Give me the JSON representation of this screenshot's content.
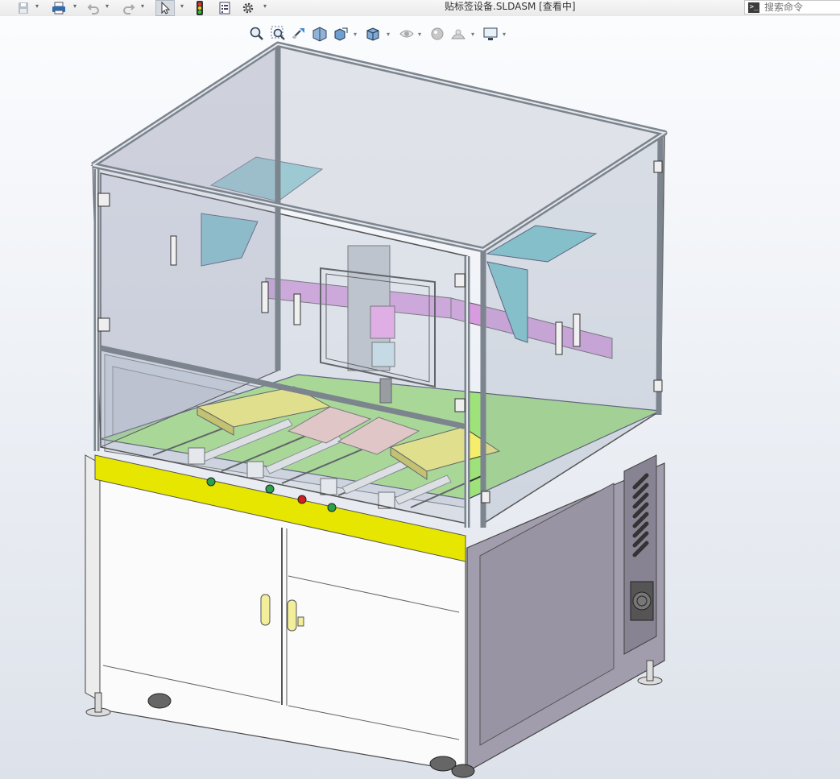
{
  "window": {
    "title": "贴标签设备.SLDASM [查看中]"
  },
  "search": {
    "placeholder": "搜索命令",
    "icon": "terminal-icon"
  },
  "toolbar": {
    "items": [
      "save-icon",
      "print-icon",
      "undo-icon",
      "redo-icon",
      "select-arrow-icon",
      "rebuild-traffic-light-icon",
      "file-properties-icon",
      "options-gear-icon"
    ]
  },
  "heads_up_toolbar": {
    "items": [
      "zoom-to-fit-icon",
      "zoom-to-area-icon",
      "previous-view-icon",
      "section-view-icon",
      "view-orientation-icon",
      "display-style-icon",
      "hide-show-items-icon",
      "edit-appearance-icon",
      "apply-scene-icon",
      "view-settings-icon"
    ]
  },
  "colors": {
    "frame": "#9aa3ad",
    "glass": "#b9c3d1",
    "base_plate": "#9ee27a",
    "bumper": "#e6e600",
    "cabinet_door": "#fbfbfb",
    "side_panel": "#9f9aa9",
    "bracket": "#70c7cf",
    "slider": "#d89be0",
    "label_pad": "#f4c8c0",
    "fixture": "#f5ee6a"
  }
}
